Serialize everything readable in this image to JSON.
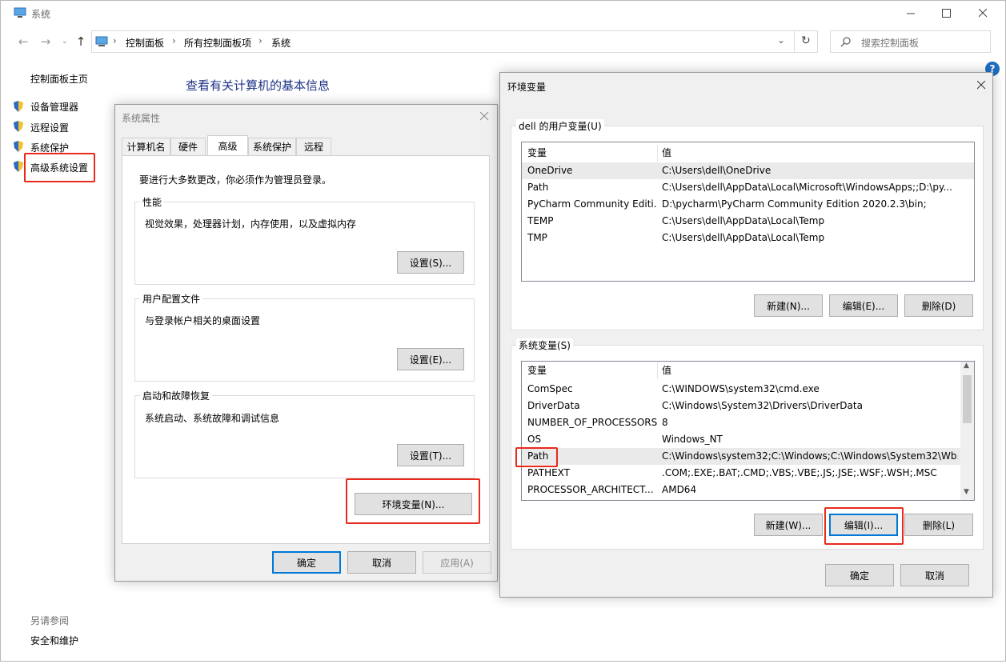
{
  "main_window": {
    "title": "系统",
    "breadcrumb": [
      "控制面板",
      "所有控制面板项",
      "系统"
    ],
    "search_placeholder": "搜索控制面板",
    "help": "?",
    "left_nav": {
      "home": "控制面板主页",
      "items": [
        "设备管理器",
        "远程设置",
        "系统保护",
        "高级系统设置"
      ],
      "see_also_header": "另请参阅",
      "see_also_items": [
        "安全和维护"
      ]
    },
    "heading": "查看有关计算机的基本信息"
  },
  "system_properties": {
    "title": "系统属性",
    "tabs": [
      "计算机名",
      "硬件",
      "高级",
      "系统保护",
      "远程"
    ],
    "active_tab": "高级",
    "admin_note": "要进行大多数更改，你必须作为管理员登录。",
    "performance": {
      "title": "性能",
      "desc": "视觉效果，处理器计划，内存使用，以及虚拟内存",
      "button": "设置(S)..."
    },
    "user_profile": {
      "title": "用户配置文件",
      "desc": "与登录帐户相关的桌面设置",
      "button": "设置(E)..."
    },
    "startup": {
      "title": "启动和故障恢复",
      "desc": "系统启动、系统故障和调试信息",
      "button": "设置(T)..."
    },
    "env_button": "环境变量(N)...",
    "ok": "确定",
    "cancel": "取消",
    "apply": "应用(A)"
  },
  "env_vars": {
    "title": "环境变量",
    "user_group_title": "dell 的用户变量(U)",
    "col_var": "变量",
    "col_val": "值",
    "user_vars": [
      {
        "name": "OneDrive",
        "value": "C:\\Users\\dell\\OneDrive"
      },
      {
        "name": "Path",
        "value": "C:\\Users\\dell\\AppData\\Local\\Microsoft\\WindowsApps;;D:\\py..."
      },
      {
        "name": "PyCharm Community Editi...",
        "value": "D:\\pycharm\\PyCharm Community Edition 2020.2.3\\bin;"
      },
      {
        "name": "TEMP",
        "value": "C:\\Users\\dell\\AppData\\Local\\Temp"
      },
      {
        "name": "TMP",
        "value": "C:\\Users\\dell\\AppData\\Local\\Temp"
      }
    ],
    "user_buttons": {
      "new": "新建(N)...",
      "edit": "编辑(E)...",
      "delete": "删除(D)"
    },
    "sys_group_title": "系统变量(S)",
    "sys_vars": [
      {
        "name": "ComSpec",
        "value": "C:\\WINDOWS\\system32\\cmd.exe"
      },
      {
        "name": "DriverData",
        "value": "C:\\Windows\\System32\\Drivers\\DriverData"
      },
      {
        "name": "NUMBER_OF_PROCESSORS",
        "value": "8"
      },
      {
        "name": "OS",
        "value": "Windows_NT"
      },
      {
        "name": "Path",
        "value": "C:\\Windows\\system32;C:\\Windows;C:\\Windows\\System32\\Wb..."
      },
      {
        "name": "PATHEXT",
        "value": ".COM;.EXE;.BAT;.CMD;.VBS;.VBE;.JS;.JSE;.WSF;.WSH;.MSC"
      },
      {
        "name": "PROCESSOR_ARCHITECT...",
        "value": "AMD64"
      }
    ],
    "sys_buttons": {
      "new": "新建(W)...",
      "edit": "编辑(I)...",
      "delete": "删除(L)"
    },
    "ok": "确定",
    "cancel": "取消"
  }
}
